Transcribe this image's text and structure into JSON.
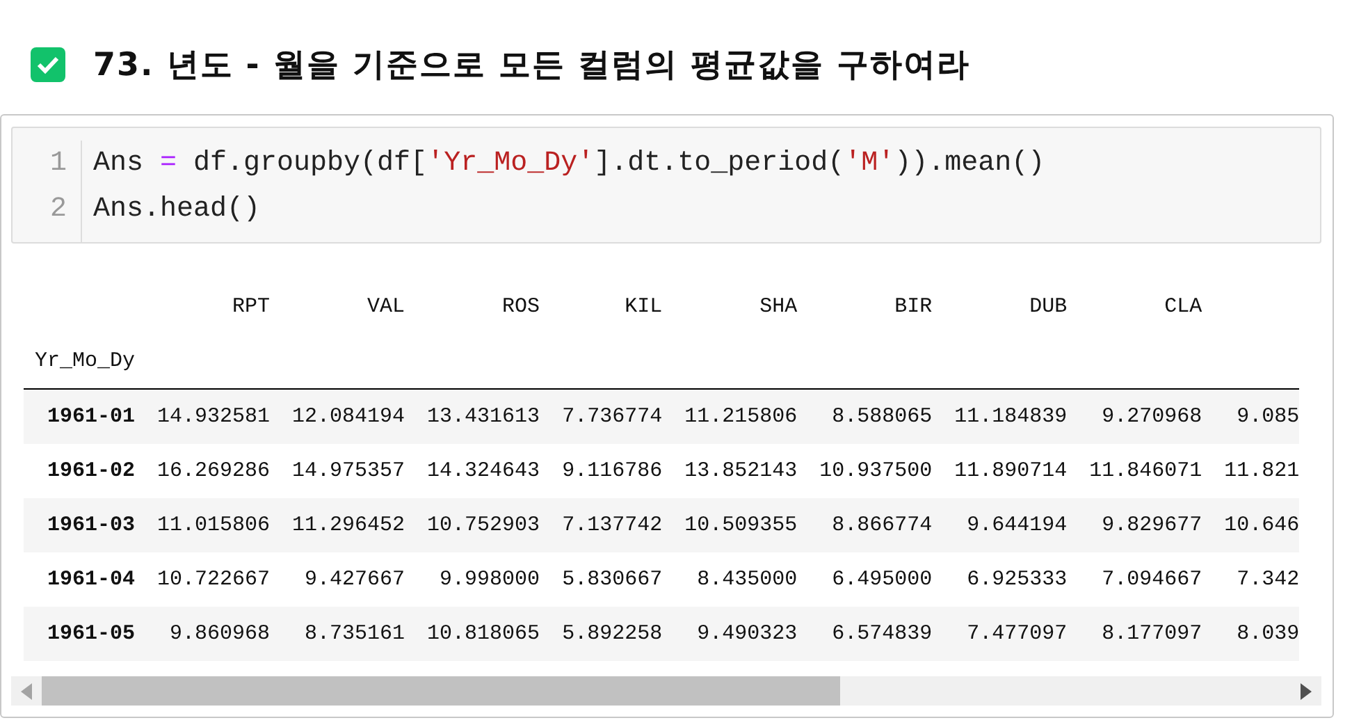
{
  "heading": {
    "checked": true,
    "title": "73. 년도 - 월을 기준으로 모든 컬럼의 평균값을 구하여라"
  },
  "code": {
    "lines": [
      {
        "number": "1",
        "tokens": [
          {
            "kind": "plain",
            "text": "Ans "
          },
          {
            "kind": "operator",
            "text": "="
          },
          {
            "kind": "plain",
            "text": " df.groupby(df["
          },
          {
            "kind": "string",
            "text": "'Yr_Mo_Dy'"
          },
          {
            "kind": "plain",
            "text": "].dt.to_period("
          },
          {
            "kind": "string",
            "text": "'M'"
          },
          {
            "kind": "plain",
            "text": ")).mean()"
          }
        ]
      },
      {
        "number": "2",
        "tokens": [
          {
            "kind": "plain",
            "text": "Ans.head()"
          }
        ]
      }
    ]
  },
  "table": {
    "columns": [
      "RPT",
      "VAL",
      "ROS",
      "KIL",
      "SHA",
      "BIR",
      "DUB",
      "CLA"
    ],
    "index_name": "Yr_Mo_Dy",
    "rows": [
      {
        "index": "1961-01",
        "values": [
          "14.932581",
          "12.084194",
          "13.431613",
          "7.736774",
          "11.215806",
          "8.588065",
          "11.184839",
          "9.270968",
          "9.085"
        ]
      },
      {
        "index": "1961-02",
        "values": [
          "16.269286",
          "14.975357",
          "14.324643",
          "9.116786",
          "13.852143",
          "10.937500",
          "11.890714",
          "11.846071",
          "11.821"
        ]
      },
      {
        "index": "1961-03",
        "values": [
          "11.015806",
          "11.296452",
          "10.752903",
          "7.137742",
          "10.509355",
          "8.866774",
          "9.644194",
          "9.829677",
          "10.646"
        ]
      },
      {
        "index": "1961-04",
        "values": [
          "10.722667",
          "9.427667",
          "9.998000",
          "5.830667",
          "8.435000",
          "6.495000",
          "6.925333",
          "7.094667",
          "7.342"
        ]
      },
      {
        "index": "1961-05",
        "values": [
          "9.860968",
          "8.735161",
          "10.818065",
          "5.892258",
          "9.490323",
          "6.574839",
          "7.477097",
          "8.177097",
          "8.039"
        ]
      }
    ]
  }
}
